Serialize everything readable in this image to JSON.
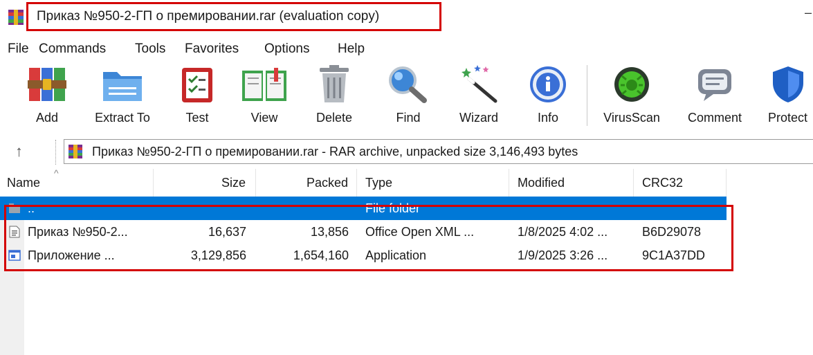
{
  "window": {
    "title": "Приказ №950-2-ГП о премировании.rar (evaluation copy)",
    "minimize_glyph": "–"
  },
  "menu": [
    "File",
    "Commands",
    "Tools",
    "Favorites",
    "Options",
    "Help"
  ],
  "toolbar": {
    "buttons": [
      {
        "label": "Add",
        "icon": "add-archive-icon"
      },
      {
        "label": "Extract To",
        "icon": "extract-folder-icon"
      },
      {
        "label": "Test",
        "icon": "test-checklist-icon"
      },
      {
        "label": "View",
        "icon": "view-book-icon"
      },
      {
        "label": "Delete",
        "icon": "trash-icon"
      },
      {
        "label": "Find",
        "icon": "magnifier-icon"
      },
      {
        "label": "Wizard",
        "icon": "magic-wand-icon"
      },
      {
        "label": "Info",
        "icon": "info-icon"
      },
      {
        "label": "VirusScan",
        "icon": "virus-scan-icon"
      },
      {
        "label": "Comment",
        "icon": "comment-icon"
      },
      {
        "label": "Protect",
        "icon": "shield-icon"
      }
    ]
  },
  "address": {
    "text": "Приказ №950-2-ГП о премировании.rar - RAR archive, unpacked size 3,146,493 bytes"
  },
  "columns": {
    "name": "Name",
    "size": "Size",
    "packed": "Packed",
    "type": "Type",
    "modified": "Modified",
    "crc": "CRC32"
  },
  "rows": [
    {
      "name": "..",
      "size": "",
      "packed": "",
      "type": "File folder",
      "modified": "",
      "crc": "",
      "icon": "parent-folder-icon"
    },
    {
      "name": "Приказ №950-2...",
      "size": "16,637",
      "packed": "13,856",
      "type": "Office Open XML ...",
      "modified": "1/8/2025 4:02 ...",
      "crc": "B6D29078",
      "icon": "document-icon"
    },
    {
      "name": "Приложение ...",
      "size": "3,129,856",
      "packed": "1,654,160",
      "type": "Application",
      "modified": "1/9/2025 3:26 ...",
      "crc": "9C1A37DD",
      "icon": "application-icon"
    }
  ],
  "colors": {
    "selection": "#0078d7",
    "highlight_box": "#d40000"
  }
}
